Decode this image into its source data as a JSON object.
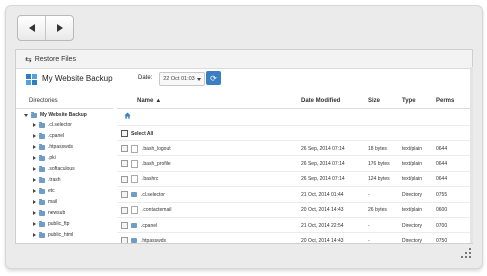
{
  "toolbar": {
    "back_label": "Back",
    "forward_label": "Forward"
  },
  "panel": {
    "title": "Restore Files"
  },
  "site": {
    "name": "My Website Backup"
  },
  "date": {
    "label": "Date:",
    "selected": "22 Oct 01:03"
  },
  "dirs": {
    "header": "Directories",
    "root": "My Website Backup",
    "items": [
      ".cl.selector",
      ".cpanel",
      ".htpasswds",
      ".pki",
      ".softaculous",
      ".trash",
      "etc",
      "mail",
      "newsub",
      "public_ftp",
      "public_html",
      "tmp"
    ]
  },
  "table": {
    "columns": {
      "name": "Name",
      "date": "Date Modified",
      "size": "Size",
      "type": "Type",
      "perms": "Perms"
    },
    "select_all": "Select All",
    "rows": [
      {
        "name": ".bash_logout",
        "date": "26 Sep, 2014 07:14",
        "size": "18 bytes",
        "type": "text/plain",
        "perms": "0644",
        "kind": "file"
      },
      {
        "name": ".bash_profile",
        "date": "26 Sep, 2014 07:14",
        "size": "176 bytes",
        "type": "text/plain",
        "perms": "0644",
        "kind": "file"
      },
      {
        "name": ".bashrc",
        "date": "26 Sep, 2014 07:14",
        "size": "124 bytes",
        "type": "text/plain",
        "perms": "0644",
        "kind": "file"
      },
      {
        "name": ".cl.selector",
        "date": "21 Oct, 2014 01:44",
        "size": "-",
        "type": "Directory",
        "perms": "0755",
        "kind": "dir"
      },
      {
        "name": ".contactemail",
        "date": "20 Oct, 2014 14:43",
        "size": "26 bytes",
        "type": "text/plain",
        "perms": "0600",
        "kind": "file"
      },
      {
        "name": ".cpanel",
        "date": "21 Oct, 2014 22:54",
        "size": "-",
        "type": "Directory",
        "perms": "0700",
        "kind": "dir"
      },
      {
        "name": ".htpasswds",
        "date": "20 Oct, 2014 14:43",
        "size": "-",
        "type": "Directory",
        "perms": "0750",
        "kind": "dir"
      }
    ]
  }
}
